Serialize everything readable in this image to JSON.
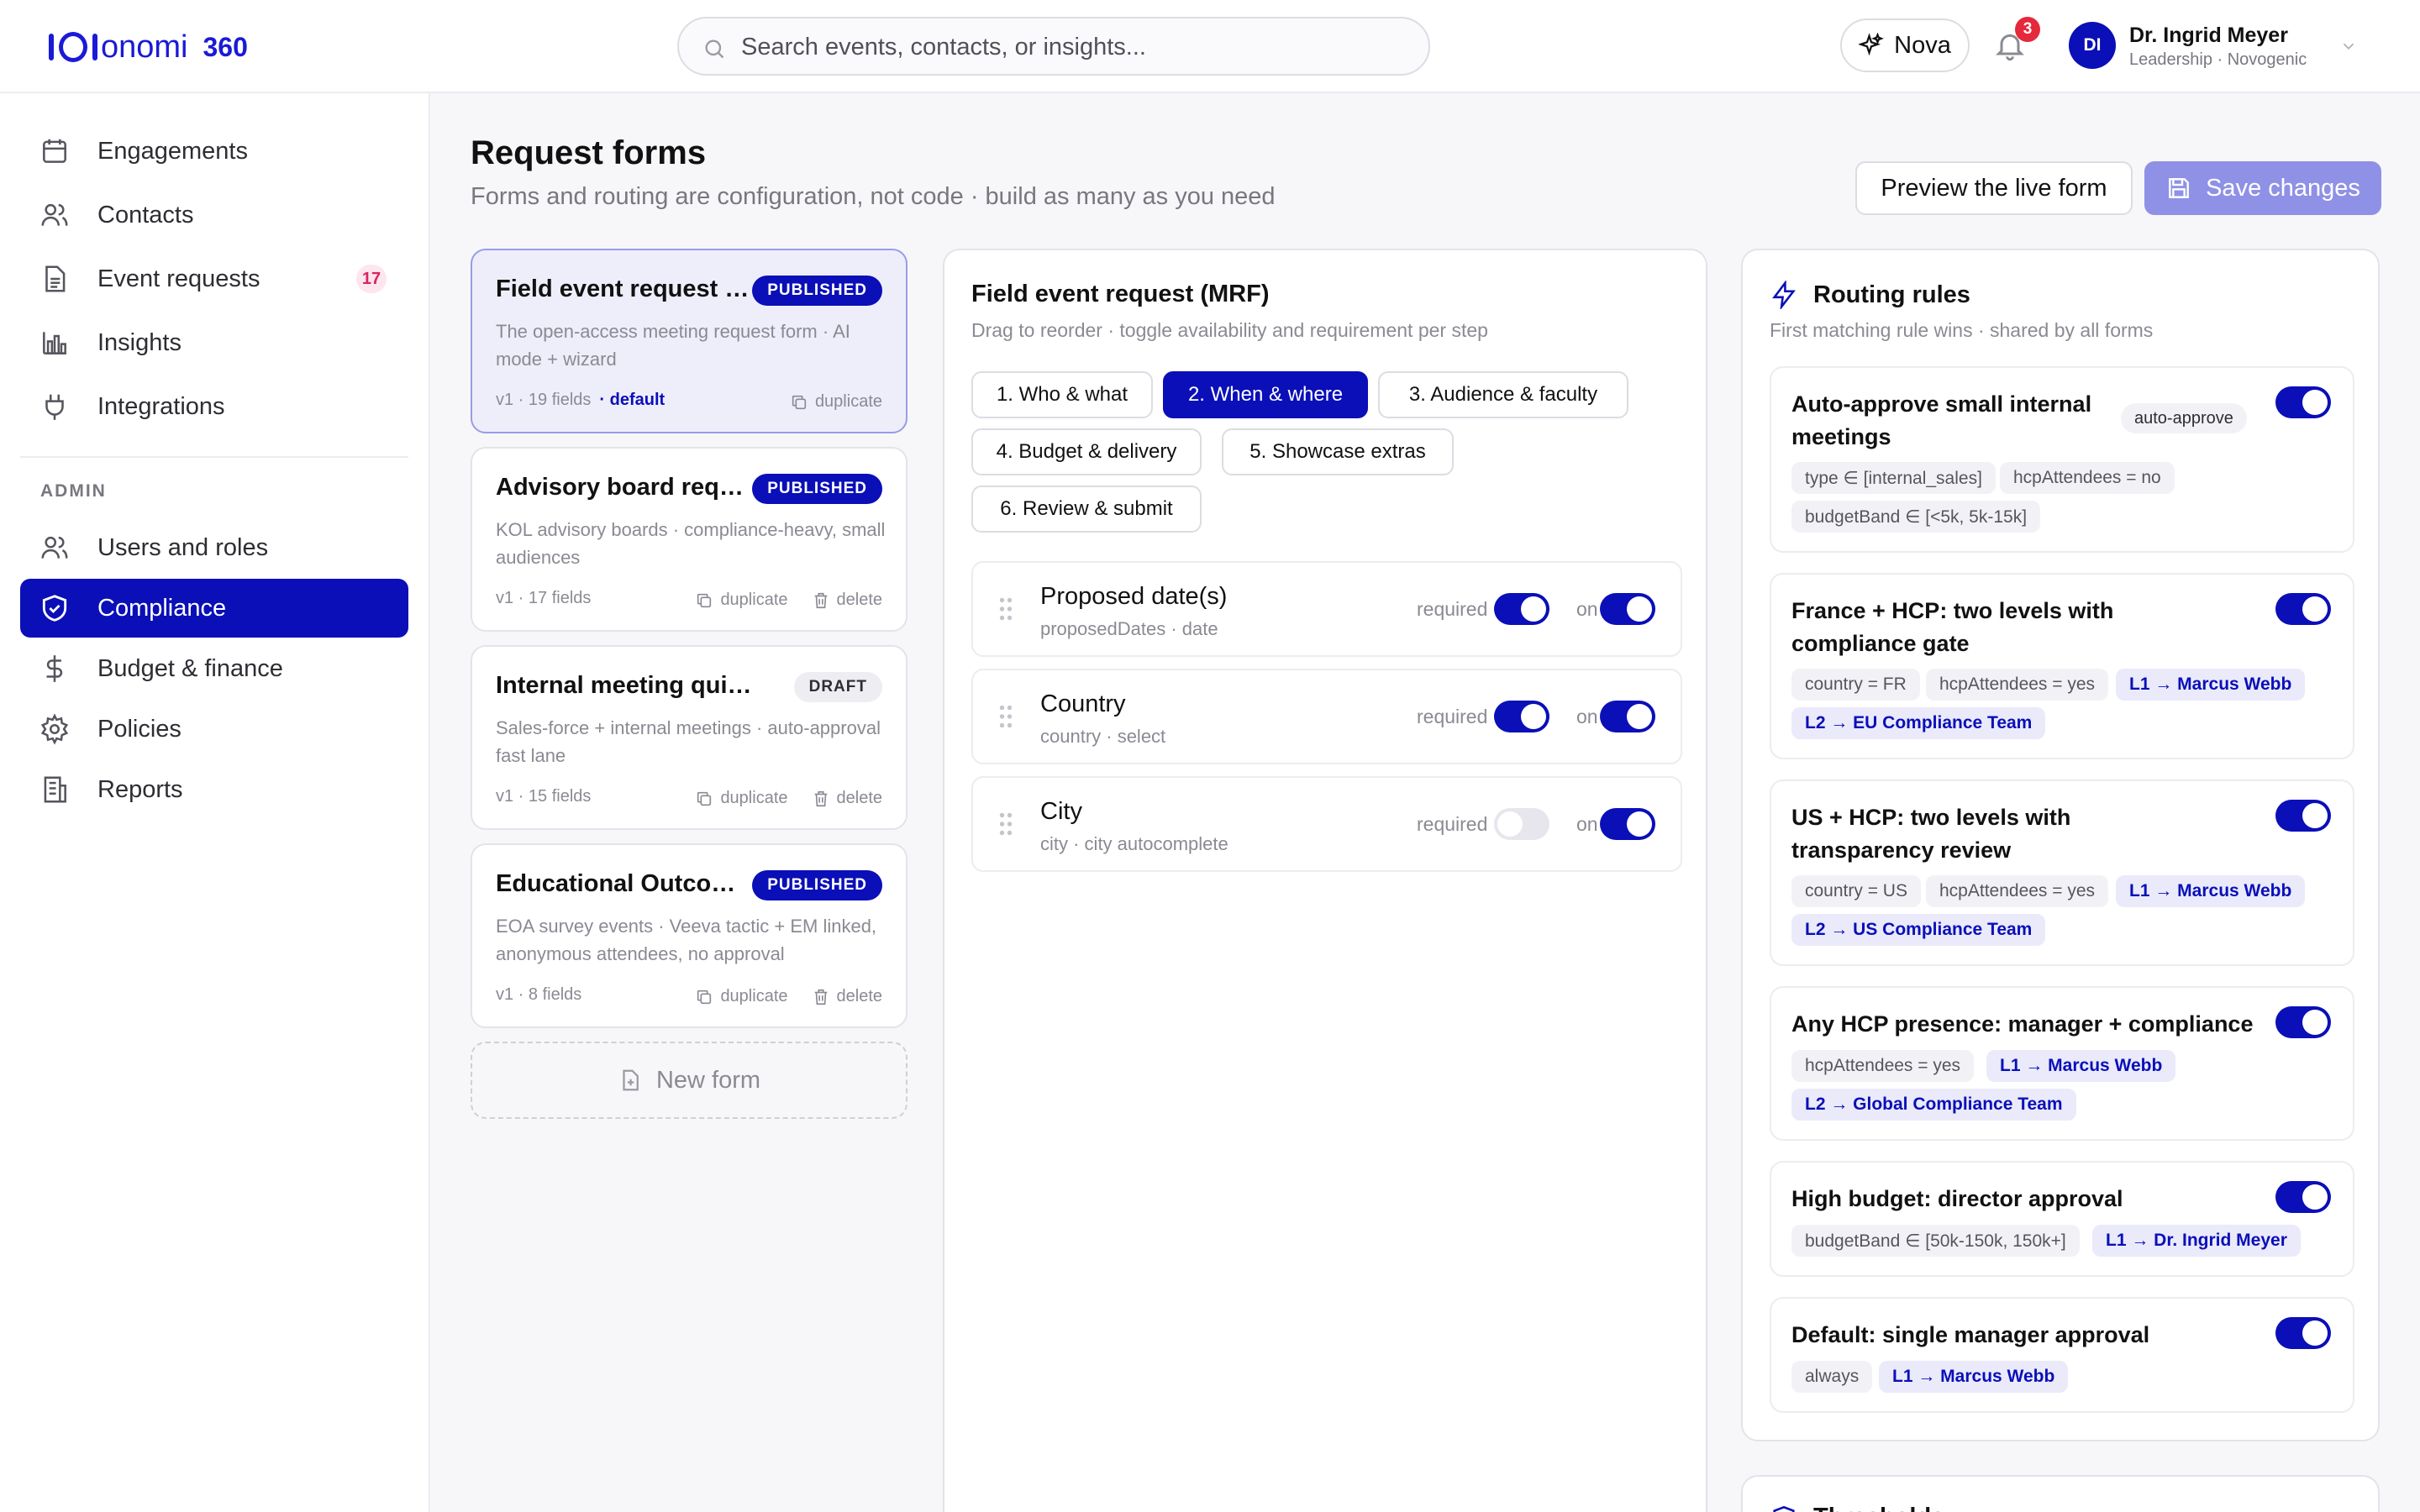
{
  "app": {
    "logo_text": "onomi",
    "logo_suffix": "360",
    "search_placeholder": "Search events, contacts, or insights...",
    "nova_label": "Nova",
    "notification_count": "3",
    "user_initials": "DI",
    "user_name": "Dr. Ingrid Meyer",
    "user_role": "Leadership · Novogenic"
  },
  "sidebar": {
    "items": [
      {
        "label": "Engagements",
        "icon": "calendar-icon"
      },
      {
        "label": "Contacts",
        "icon": "users-icon"
      },
      {
        "label": "Event requests",
        "icon": "document-icon",
        "badge": "17"
      },
      {
        "label": "Insights",
        "icon": "bar-chart-icon"
      },
      {
        "label": "Integrations",
        "icon": "plug-icon"
      }
    ],
    "admin_label": "ADMIN",
    "admin_items": [
      {
        "label": "Users and roles",
        "icon": "users-icon"
      },
      {
        "label": "Compliance",
        "icon": "shield-icon",
        "active": true
      },
      {
        "label": "Budget & finance",
        "icon": "dollar-icon"
      },
      {
        "label": "Policies",
        "icon": "gear-icon"
      },
      {
        "label": "Reports",
        "icon": "building-icon"
      }
    ]
  },
  "page": {
    "title": "Request forms",
    "subtitle": "Forms and routing are configuration, not code · build as many as you need",
    "preview_label": "Preview the live form",
    "save_label": "Save changes"
  },
  "forms": [
    {
      "title": "Field event request (MRF)",
      "badge": "PUBLISHED",
      "desc": "The open-access meeting request form · AI mode + wizard",
      "meta": "v1 · 19 fields",
      "default_label": "· default",
      "duplicate": "duplicate"
    },
    {
      "title": "Advisory board request",
      "badge": "PUBLISHED",
      "desc": "KOL advisory boards · compliance-heavy, small audiences",
      "meta": "v1 · 17 fields",
      "duplicate": "duplicate",
      "delete": "delete"
    },
    {
      "title": "Internal meeting quick form",
      "badge": "DRAFT",
      "desc": "Sales-force + internal meetings · auto-approval fast lane",
      "meta": "v1 · 15 fields",
      "duplicate": "duplicate",
      "delete": "delete"
    },
    {
      "title": "Educational Outcomes",
      "badge": "PUBLISHED",
      "desc": "EOA survey events · Veeva tactic + EM linked, anonymous attendees, no approval",
      "meta": "v1 · 8 fields",
      "duplicate": "duplicate",
      "delete": "delete"
    }
  ],
  "new_form_label": "New form",
  "editor": {
    "title": "Field event request (MRF)",
    "subtitle": "Drag to reorder · toggle availability and requirement per step",
    "steps": [
      "1. Who & what",
      "2. When & where",
      "3. Audience & faculty",
      "4. Budget & delivery",
      "5. Showcase extras",
      "6. Review & submit"
    ],
    "active_step": 1,
    "required_label": "required",
    "on_label": "on",
    "fields": [
      {
        "name": "Proposed date(s)",
        "sub": "proposedDates · date",
        "required": true,
        "on": true
      },
      {
        "name": "Country",
        "sub": "country · select",
        "required": true,
        "on": true
      },
      {
        "name": "City",
        "sub": "city · city autocomplete",
        "required": false,
        "on": true
      }
    ]
  },
  "routing": {
    "title": "Routing rules",
    "subtitle": "First matching rule wins · shared by all forms",
    "rules": [
      {
        "title": "Auto-approve small internal meetings",
        "tag": "auto-approve",
        "chips": [
          "type ∈ [internal_sales]",
          "hcpAttendees = no",
          "budgetBand ∈ [<5k, 5k-15k]"
        ],
        "enabled": true
      },
      {
        "title": "France + HCP: two levels with compliance gate",
        "chips": [
          "country = FR",
          "hcpAttendees = yes",
          "L1 → Marcus Webb",
          "L2 → EU Compliance Team"
        ],
        "enabled": true
      },
      {
        "title": "US + HCP: two levels with transparency review",
        "chips": [
          "country = US",
          "hcpAttendees = yes",
          "L1 → Marcus Webb",
          "L2 → US Compliance Team"
        ],
        "enabled": true
      },
      {
        "title": "Any HCP presence: manager + compliance",
        "chips": [
          "hcpAttendees = yes",
          "L1 → Marcus Webb",
          "L2 → Global Compliance Team"
        ],
        "enabled": true
      },
      {
        "title": "High budget: director approval",
        "chips": [
          "budgetBand ∈ [50k-150k, 150k+]",
          "L1 → Dr. Ingrid Meyer"
        ],
        "enabled": true
      },
      {
        "title": "Default: single manager approval",
        "chips": [
          "always",
          "L1 → Marcus Webb"
        ],
        "enabled": true
      }
    ]
  },
  "thresholds": {
    "title": "Thresholds"
  },
  "colors": {
    "primary": "#0a0fb8",
    "save_disabled": "#8f91e6",
    "badge_pink": "#d8245e",
    "notification_red": "#e5283c"
  }
}
